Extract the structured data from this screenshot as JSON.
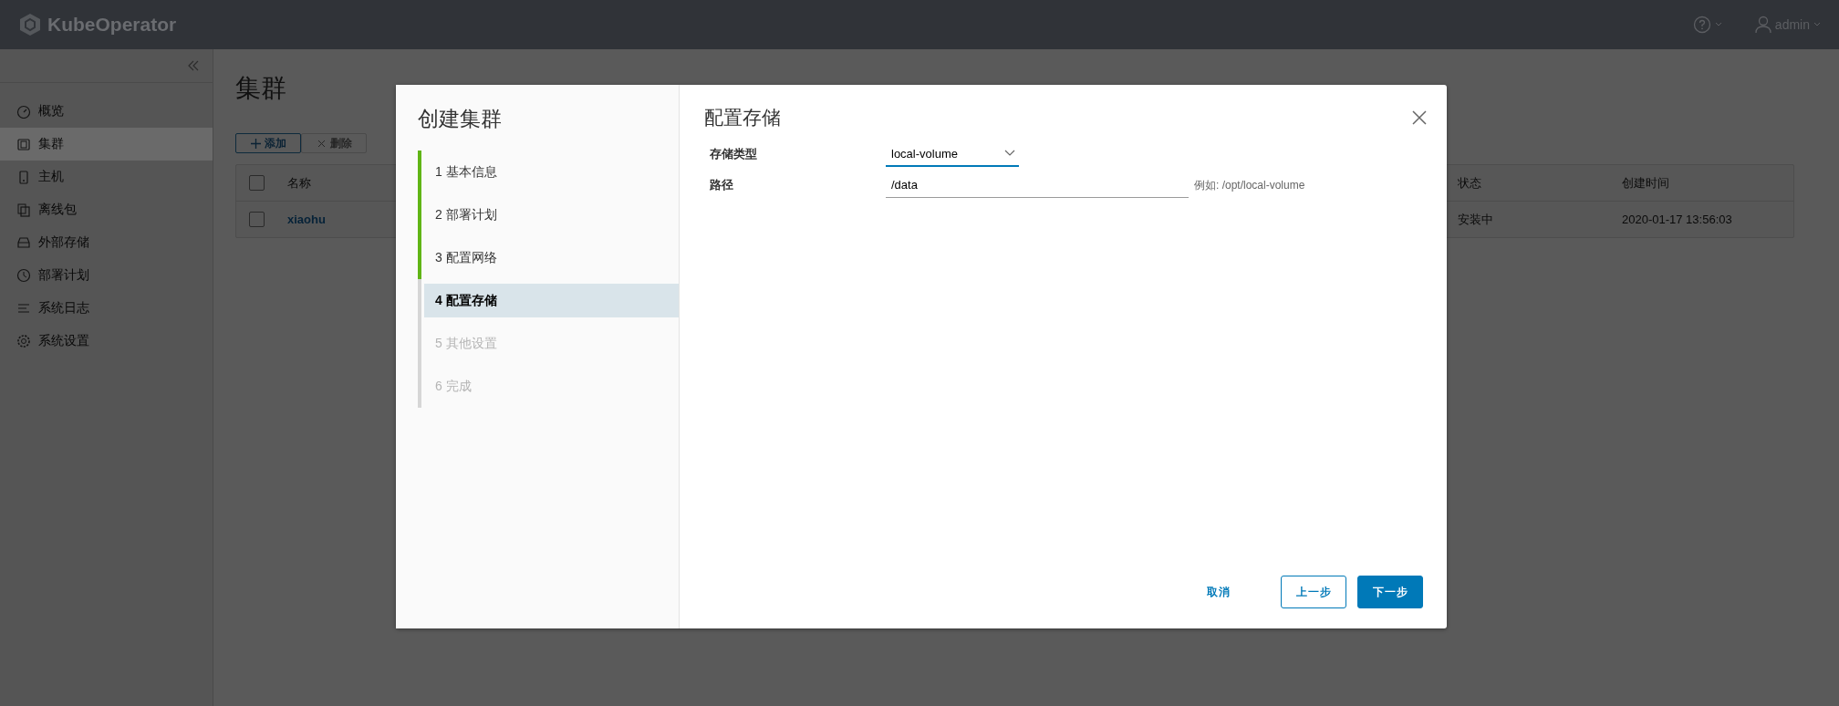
{
  "header": {
    "brand": "KubeOperator",
    "user": "admin"
  },
  "sidebar": {
    "items": [
      {
        "label": "概览",
        "selected": false
      },
      {
        "label": "集群",
        "selected": true
      },
      {
        "label": "主机",
        "selected": false
      },
      {
        "label": "离线包",
        "selected": false
      },
      {
        "label": "外部存储",
        "selected": false
      },
      {
        "label": "部署计划",
        "selected": false
      },
      {
        "label": "系统日志",
        "selected": false
      },
      {
        "label": "系统设置",
        "selected": false
      }
    ]
  },
  "page": {
    "title": "集群",
    "toolbar": [
      {
        "label": "添加",
        "kind": "add",
        "disabled": false
      },
      {
        "label": "删除",
        "kind": "delete",
        "disabled": true
      }
    ],
    "table": {
      "header_checked": false,
      "columns": [
        "名称",
        "状态",
        "创建时间"
      ],
      "rows": [
        {
          "checked": false,
          "cells": [
            "xiaohu",
            "安装中",
            "2020-01-17 13:56:03"
          ]
        }
      ]
    }
  },
  "dialog": {
    "title": "创建集群",
    "steps": [
      {
        "label": "1 基本信息",
        "completed": true,
        "selected": false,
        "disabled": false
      },
      {
        "label": "2 部署计划",
        "completed": true,
        "selected": false,
        "disabled": false
      },
      {
        "label": "3 配置网络",
        "completed": true,
        "selected": false,
        "disabled": false
      },
      {
        "label": "4 配置存储",
        "completed": false,
        "selected": true,
        "disabled": false
      },
      {
        "label": "5 其他设置",
        "completed": false,
        "selected": false,
        "disabled": true
      },
      {
        "label": "6 完成",
        "completed": false,
        "selected": false,
        "disabled": true
      }
    ],
    "page_title": "配置存储",
    "fields": [
      {
        "label": "存储类型",
        "kind": "select",
        "value": "local-volume"
      },
      {
        "label": "路径",
        "kind": "input",
        "value": "/data",
        "hint": "例如: /opt/local-volume"
      }
    ],
    "buttons": [
      {
        "label": "取消",
        "kind": "link"
      },
      {
        "label": "上一步",
        "kind": "outline"
      },
      {
        "label": "下一步",
        "kind": "primary"
      }
    ]
  }
}
